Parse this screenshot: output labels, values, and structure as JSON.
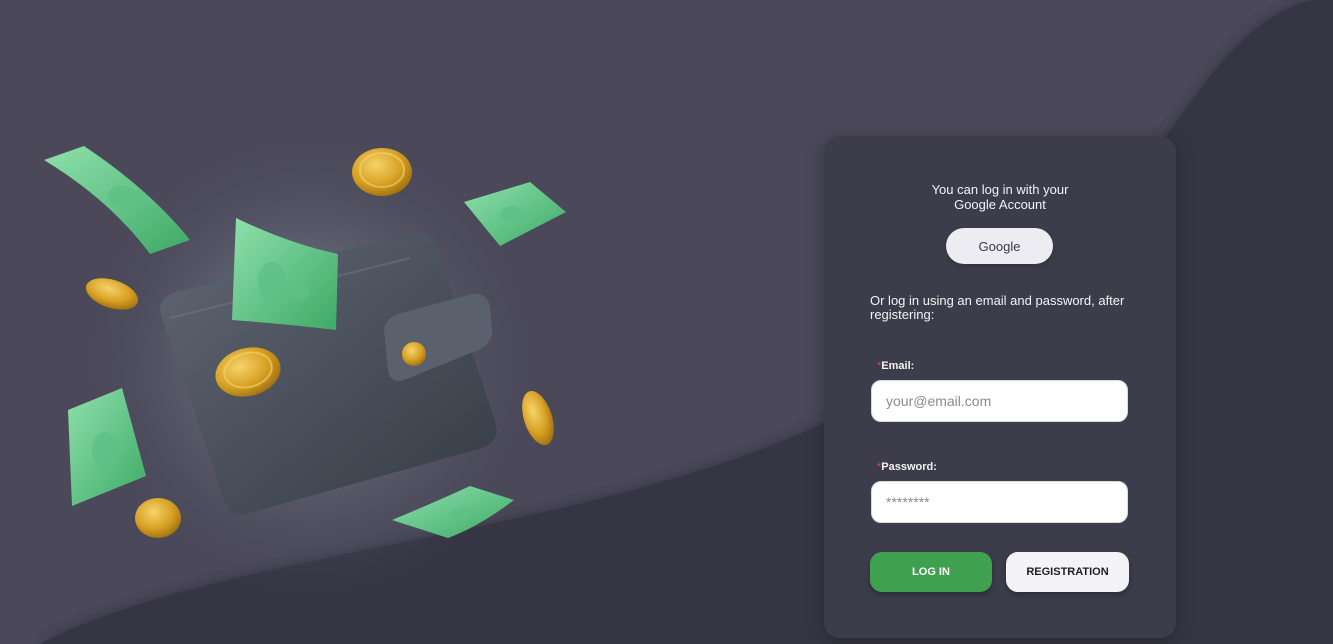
{
  "colors": {
    "background": "#4a4859",
    "wave": "#363543",
    "panel": "#3d3c4b",
    "accent_green": "#3fa14f",
    "required_mark": "#e0465a"
  },
  "illustration": {
    "name": "wallet-with-money-illustration"
  },
  "login": {
    "google_prompt_line1": "You can log in with your",
    "google_prompt_line2": "Google Account",
    "google_button": "Google",
    "alt_prompt": "Or log in using an email and password, after registering:",
    "required_mark": "*",
    "email_label": "Email:",
    "email_placeholder": "your@email.com",
    "password_label": "Password:",
    "password_placeholder": "********",
    "login_button": "LOG IN",
    "registration_button": "REGISTRATION"
  }
}
